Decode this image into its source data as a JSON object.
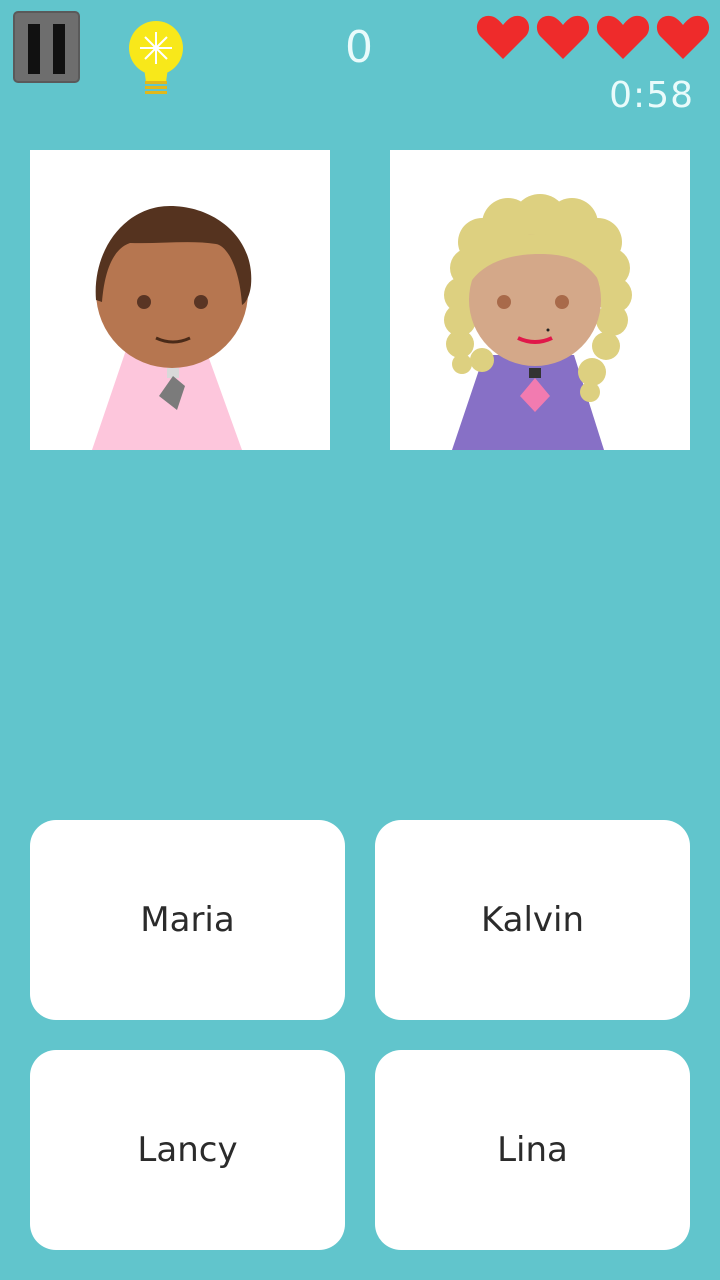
{
  "hud": {
    "score": "0",
    "timer": "0:58",
    "lives": 4,
    "heart_color": "#ee2b2b",
    "pause_icon": "pause-icon",
    "hint_icon": "lightbulb-icon"
  },
  "cards": [
    {
      "character": "boy",
      "skin": "#b67650",
      "hair": "#55331f",
      "shirt": "#fdc6dc",
      "tie": "#7b7b7b"
    },
    {
      "character": "girl",
      "skin": "#d4a889",
      "hair": "#ddd080",
      "shirt": "#8770c6",
      "tie": "#f27bb0"
    }
  ],
  "answers": [
    "Maria",
    "Kalvin",
    "Lancy",
    "Lina"
  ],
  "colors": {
    "background": "#61c5cc",
    "card": "#ffffff"
  }
}
